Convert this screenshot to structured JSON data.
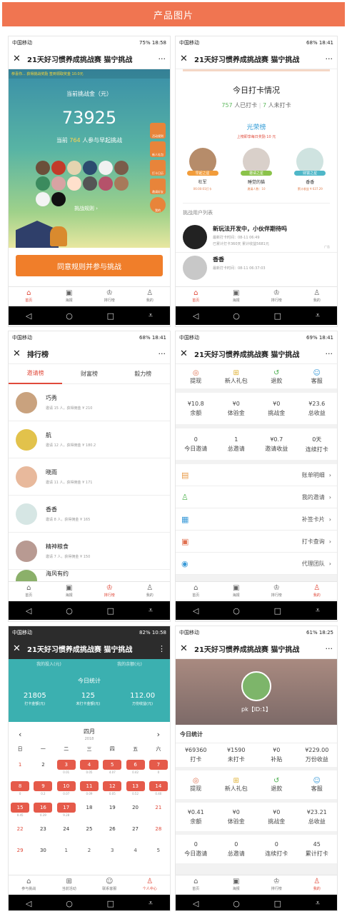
{
  "header": {
    "title": "产品图片"
  },
  "common": {
    "carrier": "中国移动",
    "more": "···",
    "close": "✕",
    "app_title": "21天好习惯养成挑战赛 猫宁挑战"
  },
  "p1": {
    "status_right": "75% 18:58",
    "marquee": "恭喜你... 获得挑战奖励 签到领取奖金 10.0元",
    "pool_label": "当前挑战金（元）",
    "pool_value": "73925",
    "participants_pre": "当前",
    "participants_num": "764",
    "participants_post": "人参与早起挑战",
    "rules": "挑战规则 ›",
    "side_btns": [
      "活动规则",
      "新人礼包",
      "打卡日历",
      "邀请好友",
      "我的"
    ],
    "cta": "同意规则并参与挑战",
    "tabs": [
      "首页",
      "海报",
      "排行榜",
      "我的"
    ]
  },
  "p2": {
    "status_right": "68% 18:41",
    "section": "今日打卡情况",
    "done_num": "757",
    "done_label": "人已打卡",
    "todo_num": "7",
    "todo_label": "人未打卡",
    "honor": "光荣榜",
    "honor_sub": "上榜即享每日奖励 10 元",
    "stars": [
      {
        "badge": "早起之星",
        "name": "杜军",
        "sub": "06:00:01打卡"
      },
      {
        "badge": "邀请之星",
        "name": "睡觉的猫",
        "sub": "邀请人数：10"
      },
      {
        "badge": "财富之星",
        "name": "香香",
        "sub": "累计收益 ¥ 637.29"
      }
    ],
    "list_title": "挑战用户列表",
    "users": [
      {
        "name": "新玩法开发中，小伙伴期待吗",
        "l1": "最新打卡时间：08-11 06:49",
        "l2": "已累计打卡360天 累计收益5681元",
        "ad": "广告"
      },
      {
        "name": "香香",
        "l1": "最新打卡时间：08-11 06:37:03",
        "l2": ""
      }
    ],
    "tabs": [
      "首页",
      "海报",
      "排行榜",
      "我的"
    ]
  },
  "p3": {
    "status_right": "68% 18:41",
    "title": "排行榜",
    "tabs": [
      "邀请榜",
      "财富榜",
      "毅力榜"
    ],
    "items": [
      {
        "name": "巧秀",
        "stat": "邀请 15 人，获得佣金 ¥ 210"
      },
      {
        "name": "航",
        "stat": "邀请 12 人，获得佣金 ¥ 180.2"
      },
      {
        "name": "晓雨",
        "stat": "邀请 11 人，获得佣金 ¥ 171"
      },
      {
        "name": "香香",
        "stat": "邀请 8 人，获得佣金 ¥ 165"
      },
      {
        "name": "精神粮食",
        "stat": "邀请 7 人，获得佣金 ¥ 150"
      },
      {
        "name": "海风有约",
        "stat": ""
      }
    ],
    "bottom": [
      "首页",
      "海报",
      "排行榜",
      "我的"
    ]
  },
  "p4": {
    "status_right": "69% 18:41",
    "quick": [
      "提现",
      "新人礼包",
      "退款",
      "客服"
    ],
    "stats1": [
      {
        "v": "¥10.8",
        "l": "余额"
      },
      {
        "v": "¥0",
        "l": "体验金"
      },
      {
        "v": "¥0",
        "l": "挑战金"
      },
      {
        "v": "¥23.6",
        "l": "总收益"
      }
    ],
    "stats2": [
      {
        "v": "0",
        "l": "今日邀请"
      },
      {
        "v": "1",
        "l": "总邀请"
      },
      {
        "v": "¥0.7",
        "l": "邀请收益"
      },
      {
        "v": "0天",
        "l": "连续打卡"
      }
    ],
    "menu": [
      "账单明细",
      "我的邀请",
      "补签卡片",
      "打卡查询",
      "代理团队"
    ],
    "tabs": [
      "首页",
      "海报",
      "排行榜",
      "我的"
    ]
  },
  "p5": {
    "status_right": "82% 10:58",
    "top_labels": [
      "我的投入(元)",
      "我的余额(元)"
    ],
    "today": "今日统计",
    "stats": [
      {
        "v": "21805",
        "l": "打卡金额(元)"
      },
      {
        "v": "125",
        "l": "未打卡金额(元)"
      },
      {
        "v": "112.00",
        "l": "万份收益(元)"
      }
    ],
    "month": "四月",
    "year": "2018",
    "weekdays": [
      "日",
      "一",
      "二",
      "三",
      "四",
      "五",
      "六"
    ],
    "days": [
      [
        "1",
        "",
        "n"
      ],
      [
        "2",
        "",
        "n"
      ],
      [
        "3",
        "0.01",
        "r"
      ],
      [
        "4",
        "0.05",
        "r"
      ],
      [
        "5",
        "4.07",
        "r"
      ],
      [
        "6",
        "0.42",
        "r"
      ],
      [
        "7",
        "0",
        "r"
      ],
      [
        "8",
        "0",
        "r"
      ],
      [
        "9",
        "0.2",
        "r"
      ],
      [
        "10",
        "0.07",
        "r"
      ],
      [
        "11",
        "0.09",
        "r"
      ],
      [
        "12",
        "0.05",
        "r"
      ],
      [
        "13",
        "0.52",
        "r"
      ],
      [
        "14",
        "0.40",
        "r"
      ],
      [
        "15",
        "0.45",
        "r"
      ],
      [
        "16",
        "0.39",
        "r"
      ],
      [
        "17",
        "9.28",
        "r"
      ],
      [
        "18",
        "",
        "n"
      ],
      [
        "19",
        "",
        "n"
      ],
      [
        "20",
        "",
        "n"
      ],
      [
        "21",
        "",
        "w"
      ],
      [
        "22",
        "",
        "w"
      ],
      [
        "23",
        "",
        "n"
      ],
      [
        "24",
        "",
        "n"
      ],
      [
        "25",
        "",
        "n"
      ],
      [
        "26",
        "",
        "n"
      ],
      [
        "27",
        "",
        "n"
      ],
      [
        "28",
        "",
        "w"
      ],
      [
        "29",
        "",
        "w"
      ],
      [
        "30",
        "",
        "n"
      ],
      [
        "1",
        "",
        "g"
      ],
      [
        "2",
        "",
        "g"
      ],
      [
        "3",
        "",
        "g"
      ],
      [
        "4",
        "",
        "g"
      ],
      [
        "5",
        "",
        "g"
      ]
    ],
    "tabs": [
      "参与挑战",
      "当前活动",
      "联系客服",
      "个人中心"
    ]
  },
  "p6": {
    "status_right": "61% 18:25",
    "profile": "pk【ID:1】",
    "today": "今日统计",
    "stats1": [
      {
        "v": "¥69360",
        "l": "打卡"
      },
      {
        "v": "¥1590",
        "l": "未打卡"
      },
      {
        "v": "¥0",
        "l": "补贴"
      },
      {
        "v": "¥229.00",
        "l": "万份收益"
      }
    ],
    "quick": [
      "提现",
      "新人礼包",
      "退款",
      "客服"
    ],
    "stats2": [
      {
        "v": "¥0.41",
        "l": "余额"
      },
      {
        "v": "¥0",
        "l": "体验金"
      },
      {
        "v": "¥0",
        "l": "挑战金"
      },
      {
        "v": "¥23.21",
        "l": "总收益"
      }
    ],
    "stats3": [
      {
        "v": "0",
        "l": "今日邀请"
      },
      {
        "v": "0",
        "l": "总邀请"
      },
      {
        "v": "0",
        "l": "连续打卡"
      },
      {
        "v": "45",
        "l": "累计打卡"
      }
    ],
    "tabs": [
      "首页",
      "海报",
      "排行榜",
      "我的"
    ]
  },
  "sysnav": [
    "◁",
    "○",
    "□",
    "⩡"
  ]
}
